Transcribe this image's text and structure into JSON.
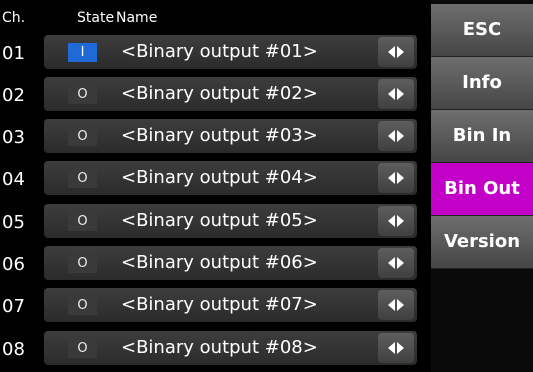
{
  "header": {
    "ch": "Ch.",
    "state": "State",
    "name": "Name"
  },
  "rows": [
    {
      "ch": "01",
      "state": "I",
      "name": "<Binary output #01>"
    },
    {
      "ch": "02",
      "state": "O",
      "name": "<Binary output #02>"
    },
    {
      "ch": "03",
      "state": "O",
      "name": "<Binary output #03>"
    },
    {
      "ch": "04",
      "state": "O",
      "name": "<Binary output #04>"
    },
    {
      "ch": "05",
      "state": "O",
      "name": "<Binary output #05>"
    },
    {
      "ch": "06",
      "state": "O",
      "name": "<Binary output #06>"
    },
    {
      "ch": "07",
      "state": "O",
      "name": "<Binary output #07>"
    },
    {
      "ch": "08",
      "state": "O",
      "name": "<Binary output #08>"
    }
  ],
  "row_icon": "left-right-arrows-icon",
  "menu": [
    {
      "label": "ESC",
      "active": false
    },
    {
      "label": "Info",
      "active": false
    },
    {
      "label": "Bin In",
      "active": false
    },
    {
      "label": "Bin Out",
      "active": true
    },
    {
      "label": "Version",
      "active": false
    }
  ],
  "colors": {
    "active_menu": "#c300c8",
    "state_on": "#1f6ad6",
    "state_off": "#3a3a3a"
  }
}
